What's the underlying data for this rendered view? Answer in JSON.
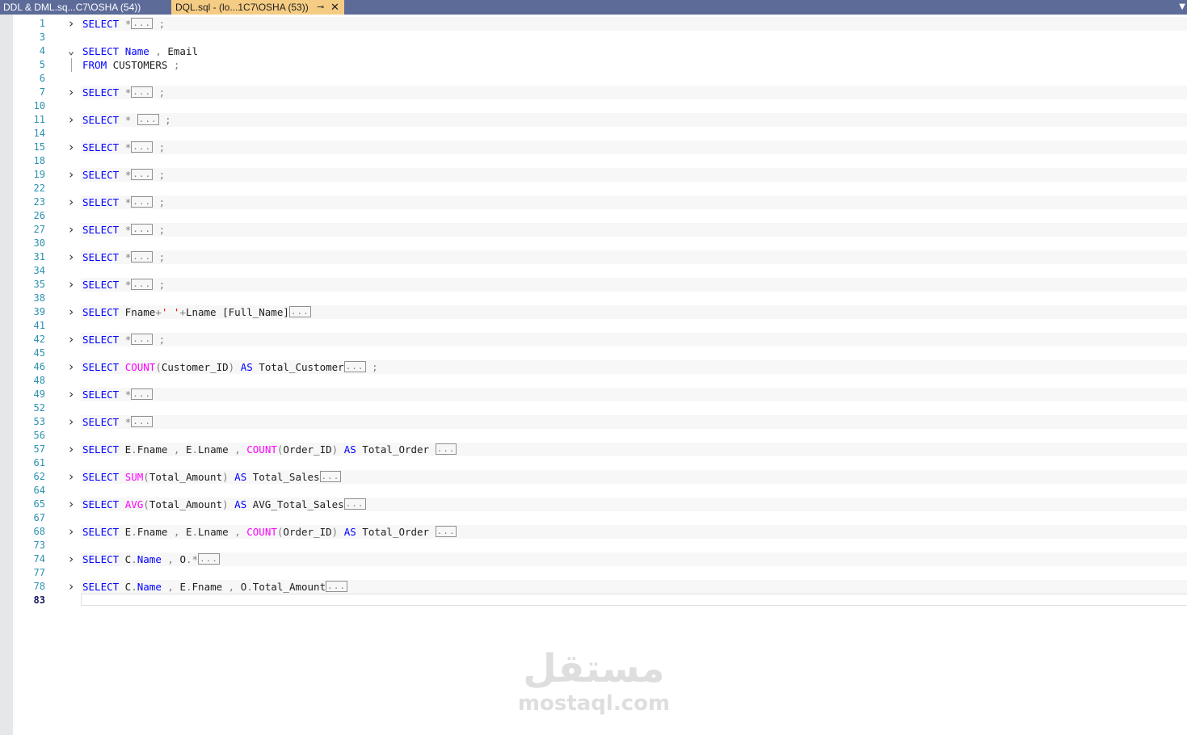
{
  "tabs": [
    {
      "label": "DDL & DML.sq...C7\\OSHA (54))",
      "active": false
    },
    {
      "label": "DQL.sql - (lo...1C7\\OSHA (53))",
      "active": true
    }
  ],
  "tab_icons": {
    "pin": "pin-icon",
    "close": "close-icon",
    "dropdown": "chevron-down-icon"
  },
  "lines": [
    {
      "num": "1",
      "fold": "collapsed",
      "tokens": [
        {
          "t": "kw",
          "v": "SELECT"
        },
        {
          "t": "tx",
          "v": " "
        },
        {
          "t": "op",
          "v": "*"
        },
        {
          "t": "box",
          "v": "..."
        },
        {
          "t": "tx",
          "v": " "
        },
        {
          "t": "op",
          "v": ";"
        }
      ]
    },
    {
      "num": "3",
      "fold": "",
      "tokens": []
    },
    {
      "num": "4",
      "fold": "expanded",
      "tokens": [
        {
          "t": "kw",
          "v": "SELECT"
        },
        {
          "t": "tx",
          "v": " "
        },
        {
          "t": "kw",
          "v": "Name"
        },
        {
          "t": "tx",
          "v": " "
        },
        {
          "t": "op",
          "v": ","
        },
        {
          "t": "tx",
          "v": " Email"
        }
      ]
    },
    {
      "num": "5",
      "fold": "guide",
      "tokens": [
        {
          "t": "kw",
          "v": "FROM"
        },
        {
          "t": "tx",
          "v": " CUSTOMERS "
        },
        {
          "t": "op",
          "v": ";"
        }
      ]
    },
    {
      "num": "6",
      "fold": "",
      "tokens": []
    },
    {
      "num": "7",
      "fold": "collapsed",
      "tokens": [
        {
          "t": "kw",
          "v": "SELECT"
        },
        {
          "t": "tx",
          "v": " "
        },
        {
          "t": "op",
          "v": "*"
        },
        {
          "t": "box",
          "v": "..."
        },
        {
          "t": "tx",
          "v": " "
        },
        {
          "t": "op",
          "v": ";"
        }
      ]
    },
    {
      "num": "10",
      "fold": "",
      "tokens": []
    },
    {
      "num": "11",
      "fold": "collapsed",
      "tokens": [
        {
          "t": "kw",
          "v": "SELECT"
        },
        {
          "t": "tx",
          "v": " "
        },
        {
          "t": "op",
          "v": "*"
        },
        {
          "t": "tx",
          "v": " "
        },
        {
          "t": "box",
          "v": "..."
        },
        {
          "t": "tx",
          "v": " "
        },
        {
          "t": "op",
          "v": ";"
        }
      ]
    },
    {
      "num": "14",
      "fold": "",
      "tokens": []
    },
    {
      "num": "15",
      "fold": "collapsed",
      "tokens": [
        {
          "t": "kw",
          "v": "SELECT"
        },
        {
          "t": "tx",
          "v": " "
        },
        {
          "t": "op",
          "v": "*"
        },
        {
          "t": "box",
          "v": "..."
        },
        {
          "t": "tx",
          "v": " "
        },
        {
          "t": "op",
          "v": ";"
        }
      ]
    },
    {
      "num": "18",
      "fold": "",
      "tokens": []
    },
    {
      "num": "19",
      "fold": "collapsed",
      "tokens": [
        {
          "t": "kw",
          "v": "SELECT"
        },
        {
          "t": "tx",
          "v": " "
        },
        {
          "t": "op",
          "v": "*"
        },
        {
          "t": "box",
          "v": "..."
        },
        {
          "t": "tx",
          "v": " "
        },
        {
          "t": "op",
          "v": ";"
        }
      ]
    },
    {
      "num": "22",
      "fold": "",
      "tokens": []
    },
    {
      "num": "23",
      "fold": "collapsed",
      "tokens": [
        {
          "t": "kw",
          "v": "SELECT"
        },
        {
          "t": "tx",
          "v": " "
        },
        {
          "t": "op",
          "v": "*"
        },
        {
          "t": "box",
          "v": "..."
        },
        {
          "t": "tx",
          "v": " "
        },
        {
          "t": "op",
          "v": ";"
        }
      ]
    },
    {
      "num": "26",
      "fold": "",
      "tokens": []
    },
    {
      "num": "27",
      "fold": "collapsed",
      "tokens": [
        {
          "t": "kw",
          "v": "SELECT"
        },
        {
          "t": "tx",
          "v": " "
        },
        {
          "t": "op",
          "v": "*"
        },
        {
          "t": "box",
          "v": "..."
        },
        {
          "t": "tx",
          "v": " "
        },
        {
          "t": "op",
          "v": ";"
        }
      ]
    },
    {
      "num": "30",
      "fold": "",
      "tokens": []
    },
    {
      "num": "31",
      "fold": "collapsed",
      "tokens": [
        {
          "t": "kw",
          "v": "SELECT"
        },
        {
          "t": "tx",
          "v": " "
        },
        {
          "t": "op",
          "v": "*"
        },
        {
          "t": "box",
          "v": "..."
        },
        {
          "t": "tx",
          "v": " "
        },
        {
          "t": "op",
          "v": ";"
        }
      ]
    },
    {
      "num": "34",
      "fold": "",
      "tokens": []
    },
    {
      "num": "35",
      "fold": "collapsed",
      "tokens": [
        {
          "t": "kw",
          "v": "SELECT"
        },
        {
          "t": "tx",
          "v": " "
        },
        {
          "t": "op",
          "v": "*"
        },
        {
          "t": "box",
          "v": "..."
        },
        {
          "t": "tx",
          "v": " "
        },
        {
          "t": "op",
          "v": ";"
        }
      ]
    },
    {
      "num": "38",
      "fold": "",
      "tokens": []
    },
    {
      "num": "39",
      "fold": "collapsed",
      "tokens": [
        {
          "t": "kw",
          "v": "SELECT"
        },
        {
          "t": "tx",
          "v": " Fname"
        },
        {
          "t": "op",
          "v": "+"
        },
        {
          "t": "str",
          "v": "' '"
        },
        {
          "t": "op",
          "v": "+"
        },
        {
          "t": "tx",
          "v": "Lname [Full_Name]"
        },
        {
          "t": "box",
          "v": "..."
        }
      ]
    },
    {
      "num": "41",
      "fold": "",
      "tokens": []
    },
    {
      "num": "42",
      "fold": "collapsed",
      "tokens": [
        {
          "t": "kw",
          "v": "SELECT"
        },
        {
          "t": "tx",
          "v": " "
        },
        {
          "t": "op",
          "v": "*"
        },
        {
          "t": "box",
          "v": "..."
        },
        {
          "t": "tx",
          "v": " "
        },
        {
          "t": "op",
          "v": ";"
        }
      ]
    },
    {
      "num": "45",
      "fold": "",
      "tokens": []
    },
    {
      "num": "46",
      "fold": "collapsed",
      "tokens": [
        {
          "t": "kw",
          "v": "SELECT"
        },
        {
          "t": "tx",
          "v": " "
        },
        {
          "t": "fn",
          "v": "COUNT"
        },
        {
          "t": "op",
          "v": "("
        },
        {
          "t": "tx",
          "v": "Customer_ID"
        },
        {
          "t": "op",
          "v": ")"
        },
        {
          "t": "tx",
          "v": " "
        },
        {
          "t": "kw",
          "v": "AS"
        },
        {
          "t": "tx",
          "v": " Total_Customer"
        },
        {
          "t": "box",
          "v": "..."
        },
        {
          "t": "tx",
          "v": " "
        },
        {
          "t": "op",
          "v": ";"
        }
      ]
    },
    {
      "num": "48",
      "fold": "",
      "tokens": []
    },
    {
      "num": "49",
      "fold": "collapsed",
      "tokens": [
        {
          "t": "kw",
          "v": "SELECT"
        },
        {
          "t": "tx",
          "v": " "
        },
        {
          "t": "op",
          "v": "*"
        },
        {
          "t": "box",
          "v": "..."
        }
      ]
    },
    {
      "num": "52",
      "fold": "",
      "tokens": []
    },
    {
      "num": "53",
      "fold": "collapsed",
      "tokens": [
        {
          "t": "kw",
          "v": "SELECT"
        },
        {
          "t": "tx",
          "v": " "
        },
        {
          "t": "op",
          "v": "*"
        },
        {
          "t": "box",
          "v": "..."
        }
      ]
    },
    {
      "num": "56",
      "fold": "",
      "tokens": []
    },
    {
      "num": "57",
      "fold": "collapsed",
      "tokens": [
        {
          "t": "kw",
          "v": "SELECT"
        },
        {
          "t": "tx",
          "v": " E"
        },
        {
          "t": "op",
          "v": "."
        },
        {
          "t": "tx",
          "v": "Fname "
        },
        {
          "t": "op",
          "v": ","
        },
        {
          "t": "tx",
          "v": " E"
        },
        {
          "t": "op",
          "v": "."
        },
        {
          "t": "tx",
          "v": "Lname "
        },
        {
          "t": "op",
          "v": ","
        },
        {
          "t": "tx",
          "v": " "
        },
        {
          "t": "fn",
          "v": "COUNT"
        },
        {
          "t": "op",
          "v": "("
        },
        {
          "t": "tx",
          "v": "Order_ID"
        },
        {
          "t": "op",
          "v": ")"
        },
        {
          "t": "tx",
          "v": " "
        },
        {
          "t": "kw",
          "v": "AS"
        },
        {
          "t": "tx",
          "v": " Total_Order "
        },
        {
          "t": "box",
          "v": "..."
        }
      ]
    },
    {
      "num": "61",
      "fold": "",
      "tokens": []
    },
    {
      "num": "62",
      "fold": "collapsed",
      "tokens": [
        {
          "t": "kw",
          "v": "SELECT"
        },
        {
          "t": "tx",
          "v": " "
        },
        {
          "t": "fn",
          "v": "SUM"
        },
        {
          "t": "op",
          "v": "("
        },
        {
          "t": "tx",
          "v": "Total_Amount"
        },
        {
          "t": "op",
          "v": ")"
        },
        {
          "t": "tx",
          "v": " "
        },
        {
          "t": "kw",
          "v": "AS"
        },
        {
          "t": "tx",
          "v": " Total_Sales"
        },
        {
          "t": "box",
          "v": "..."
        }
      ]
    },
    {
      "num": "64",
      "fold": "",
      "tokens": []
    },
    {
      "num": "65",
      "fold": "collapsed",
      "tokens": [
        {
          "t": "kw",
          "v": "SELECT"
        },
        {
          "t": "tx",
          "v": " "
        },
        {
          "t": "fn",
          "v": "AVG"
        },
        {
          "t": "op",
          "v": "("
        },
        {
          "t": "tx",
          "v": "Total_Amount"
        },
        {
          "t": "op",
          "v": ")"
        },
        {
          "t": "tx",
          "v": " "
        },
        {
          "t": "kw",
          "v": "AS"
        },
        {
          "t": "tx",
          "v": " AVG_Total_Sales"
        },
        {
          "t": "box",
          "v": "..."
        }
      ]
    },
    {
      "num": "67",
      "fold": "",
      "tokens": []
    },
    {
      "num": "68",
      "fold": "collapsed",
      "tokens": [
        {
          "t": "kw",
          "v": "SELECT"
        },
        {
          "t": "tx",
          "v": " E"
        },
        {
          "t": "op",
          "v": "."
        },
        {
          "t": "tx",
          "v": "Fname "
        },
        {
          "t": "op",
          "v": ","
        },
        {
          "t": "tx",
          "v": " E"
        },
        {
          "t": "op",
          "v": "."
        },
        {
          "t": "tx",
          "v": "Lname "
        },
        {
          "t": "op",
          "v": ","
        },
        {
          "t": "tx",
          "v": " "
        },
        {
          "t": "fn",
          "v": "COUNT"
        },
        {
          "t": "op",
          "v": "("
        },
        {
          "t": "tx",
          "v": "Order_ID"
        },
        {
          "t": "op",
          "v": ")"
        },
        {
          "t": "tx",
          "v": " "
        },
        {
          "t": "kw",
          "v": "AS"
        },
        {
          "t": "tx",
          "v": " Total_Order "
        },
        {
          "t": "box",
          "v": "..."
        }
      ]
    },
    {
      "num": "73",
      "fold": "",
      "tokens": []
    },
    {
      "num": "74",
      "fold": "collapsed",
      "tokens": [
        {
          "t": "kw",
          "v": "SELECT"
        },
        {
          "t": "tx",
          "v": " C"
        },
        {
          "t": "op",
          "v": "."
        },
        {
          "t": "kw",
          "v": "Name"
        },
        {
          "t": "tx",
          "v": " "
        },
        {
          "t": "op",
          "v": ","
        },
        {
          "t": "tx",
          "v": " O"
        },
        {
          "t": "op",
          "v": ".*"
        },
        {
          "t": "box",
          "v": "..."
        }
      ]
    },
    {
      "num": "77",
      "fold": "",
      "tokens": []
    },
    {
      "num": "78",
      "fold": "collapsed",
      "tokens": [
        {
          "t": "kw",
          "v": "SELECT"
        },
        {
          "t": "tx",
          "v": " C"
        },
        {
          "t": "op",
          "v": "."
        },
        {
          "t": "kw",
          "v": "Name"
        },
        {
          "t": "tx",
          "v": " "
        },
        {
          "t": "op",
          "v": ","
        },
        {
          "t": "tx",
          "v": " E"
        },
        {
          "t": "op",
          "v": "."
        },
        {
          "t": "tx",
          "v": "Fname "
        },
        {
          "t": "op",
          "v": ","
        },
        {
          "t": "tx",
          "v": " O"
        },
        {
          "t": "op",
          "v": "."
        },
        {
          "t": "tx",
          "v": "Total_Amount"
        },
        {
          "t": "box",
          "v": "..."
        }
      ]
    },
    {
      "num": "83",
      "fold": "",
      "current": true,
      "tokens": []
    }
  ],
  "watermark": {
    "arabic": "مستقل",
    "latin": "mostaql.com"
  },
  "colors": {
    "keyword": "#0000ff",
    "function": "#ff00ff",
    "operator": "#808080",
    "string": "#ff0000",
    "line_number": "#2b91af",
    "tab_bar": "#5d6b99",
    "active_tab": "#f5cc84"
  }
}
